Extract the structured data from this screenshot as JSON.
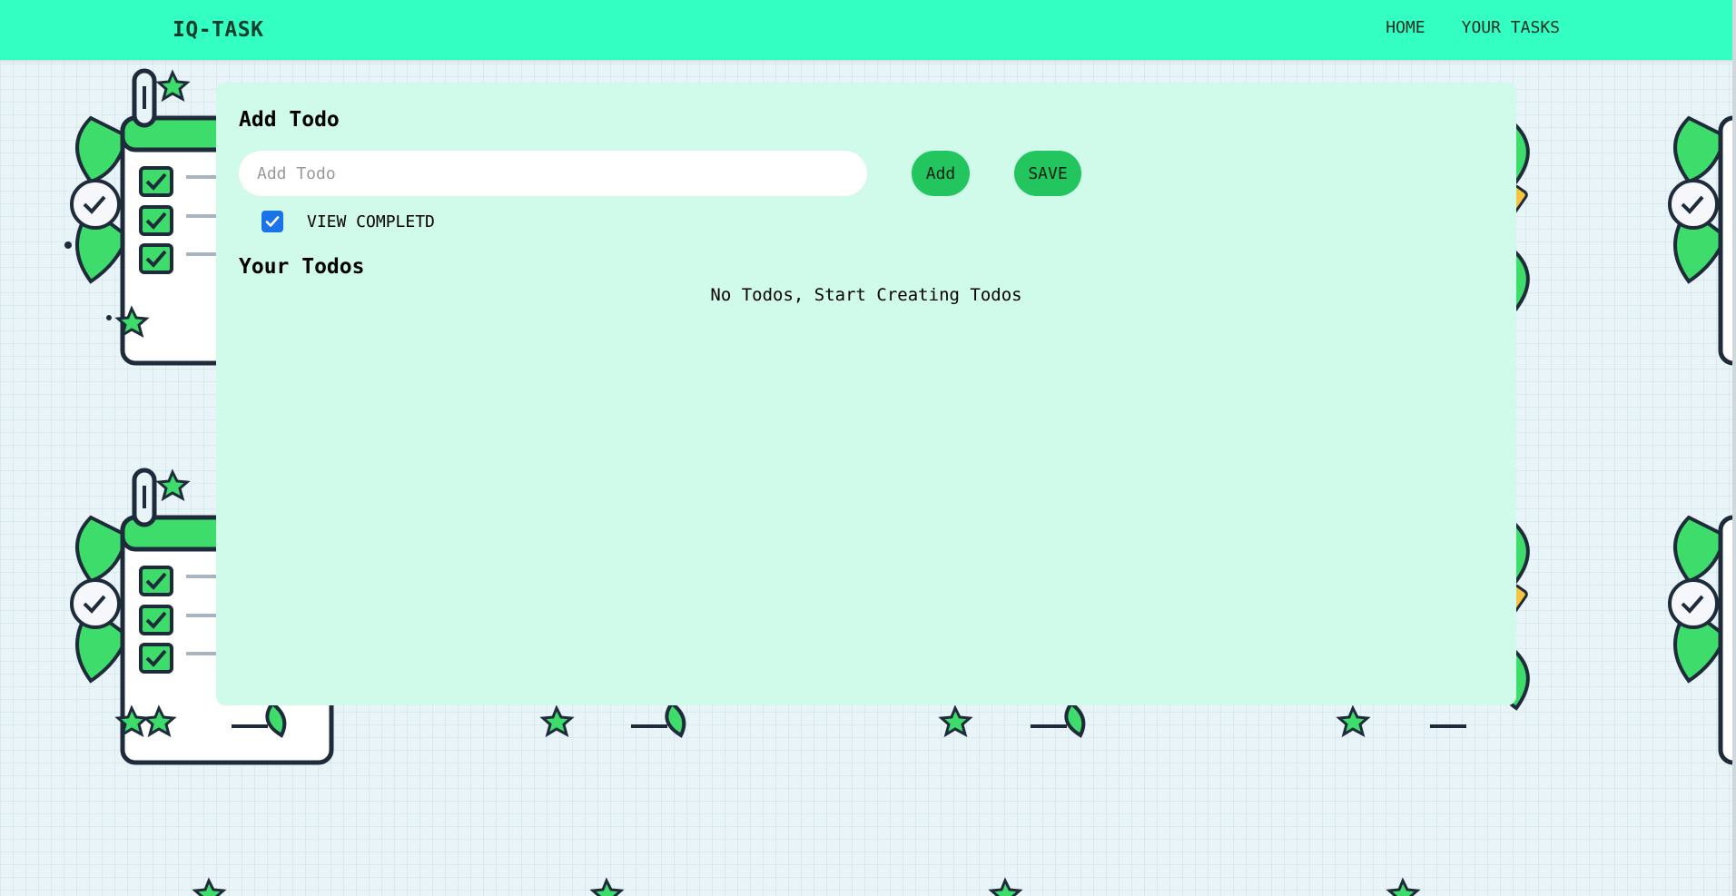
{
  "app": {
    "brand": "IQ-TASK"
  },
  "nav": {
    "items": [
      {
        "label": "HOME"
      },
      {
        "label": "YOUR TASKS"
      }
    ]
  },
  "add_section": {
    "title": "Add Todo",
    "input": {
      "placeholder": "Add Todo",
      "value": ""
    },
    "add_label": "Add",
    "save_label": "SAVE"
  },
  "view_completed": {
    "label": "VIEW COMPLETD",
    "checked": true
  },
  "todos_section": {
    "title": "Your Todos",
    "empty_message": "No Todos, Start Creating Todos",
    "items": []
  },
  "colors": {
    "navbar": "#33ffc3",
    "panel": "#d0faea",
    "button": "#22c55e",
    "checkbox": "#1a73e8",
    "page_background": "#e8f4f7"
  },
  "icons": {
    "background_tile": "checklist-clipboard-icon",
    "checkbox_mark": "checkmark-icon"
  }
}
